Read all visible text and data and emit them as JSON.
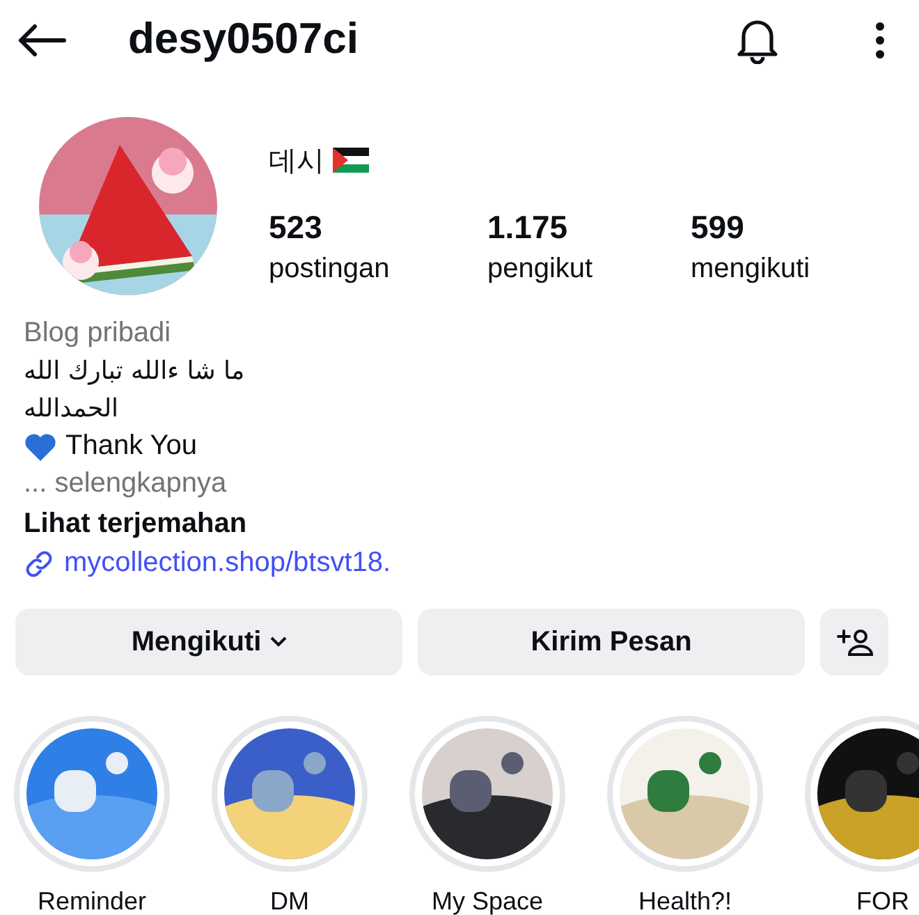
{
  "header": {
    "username": "desy0507ci"
  },
  "profile": {
    "display_name": "데시",
    "stats": [
      {
        "value": "523",
        "label": "postingan"
      },
      {
        "value": "1.175",
        "label": "pengikut"
      },
      {
        "value": "599",
        "label": "mengikuti"
      }
    ]
  },
  "bio": {
    "category": "Blog pribadi",
    "lines": [
      {
        "kind": "rtl",
        "text": "ما شا ءالله تبارك الله"
      },
      {
        "kind": "rtl",
        "text": "الحمدالله"
      },
      {
        "kind": "heart",
        "text": "Thank You"
      }
    ],
    "more": "... selengkapnya",
    "translate": "Lihat terjemahan",
    "link": "mycollection.shop/btsvt18."
  },
  "buttons": [
    {
      "kind": "dropdown",
      "label": "Mengikuti"
    },
    {
      "kind": "plain",
      "label": "Kirim Pesan"
    },
    {
      "kind": "add-person"
    }
  ],
  "highlights": [
    {
      "label": "Reminder"
    },
    {
      "label": "DM"
    },
    {
      "label": "My Space"
    },
    {
      "label": "Health?!"
    },
    {
      "label": "FOR"
    }
  ]
}
